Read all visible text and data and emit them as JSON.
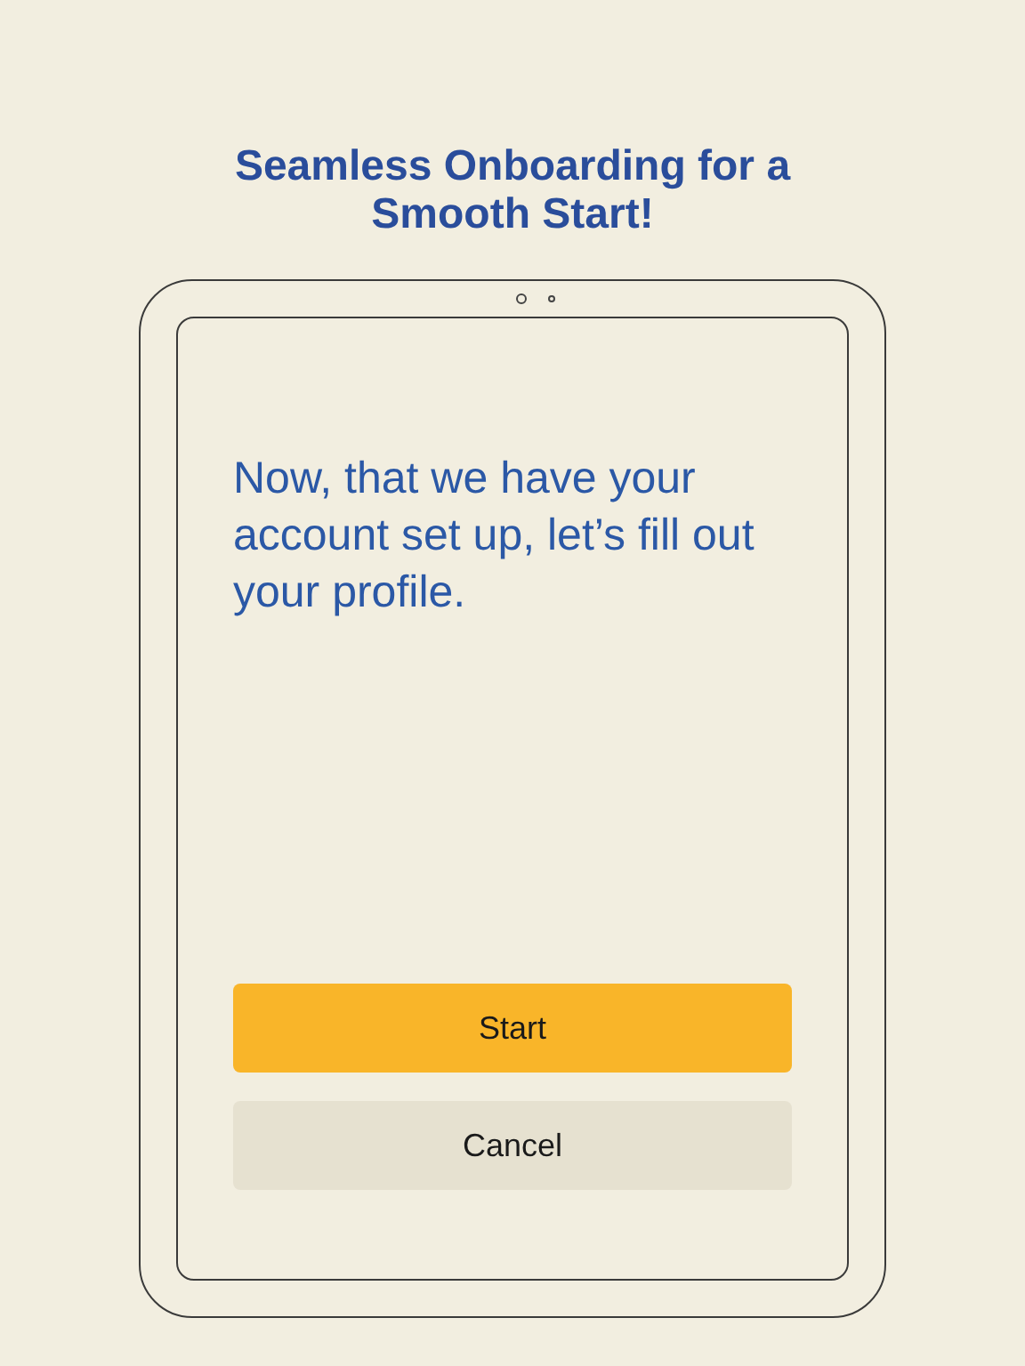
{
  "headline": "Seamless Onboarding for a Smooth Start!",
  "screen": {
    "message": "Now, that we have your account set up, let’s fill out your profile.",
    "buttons": [
      {
        "label": "Start",
        "kind": "primary"
      },
      {
        "label": "Cancel",
        "kind": "secondary"
      }
    ]
  }
}
